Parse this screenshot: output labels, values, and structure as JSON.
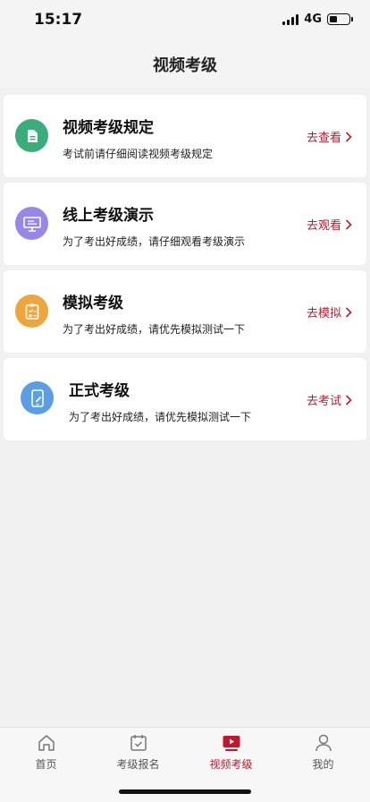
{
  "status_bar": {
    "time": "15:17",
    "network": "4G"
  },
  "header": {
    "title": "视频考级"
  },
  "cards": [
    {
      "title": "视频考级规定",
      "desc": "考试前请仔细阅读视频考级规定",
      "action": "去查看",
      "icon": "document-icon",
      "color": "#3aad7a"
    },
    {
      "title": "线上考级演示",
      "desc": "为了考出好成绩，请仔细观看考级演示",
      "action": "去观看",
      "icon": "presentation-icon",
      "color": "#9a86e8"
    },
    {
      "title": "模拟考级",
      "desc": "为了考出好成绩，请优先模拟测试一下",
      "action": "去模拟",
      "icon": "clipboard-icon",
      "color": "#eea53c"
    },
    {
      "title": "正式考级",
      "desc": "为了考出好成绩，请优先模拟测试一下",
      "action": "去考试",
      "icon": "mobile-exam-icon",
      "color": "#5b9ee6"
    }
  ],
  "tabs": [
    {
      "label": "首页",
      "icon": "home-icon"
    },
    {
      "label": "考级报名",
      "icon": "calendar-check-icon"
    },
    {
      "label": "视频考级",
      "icon": "video-play-icon",
      "active": true
    },
    {
      "label": "我的",
      "icon": "user-icon"
    }
  ],
  "colors": {
    "accent": "#c0182c",
    "background": "#f1f1f1"
  }
}
